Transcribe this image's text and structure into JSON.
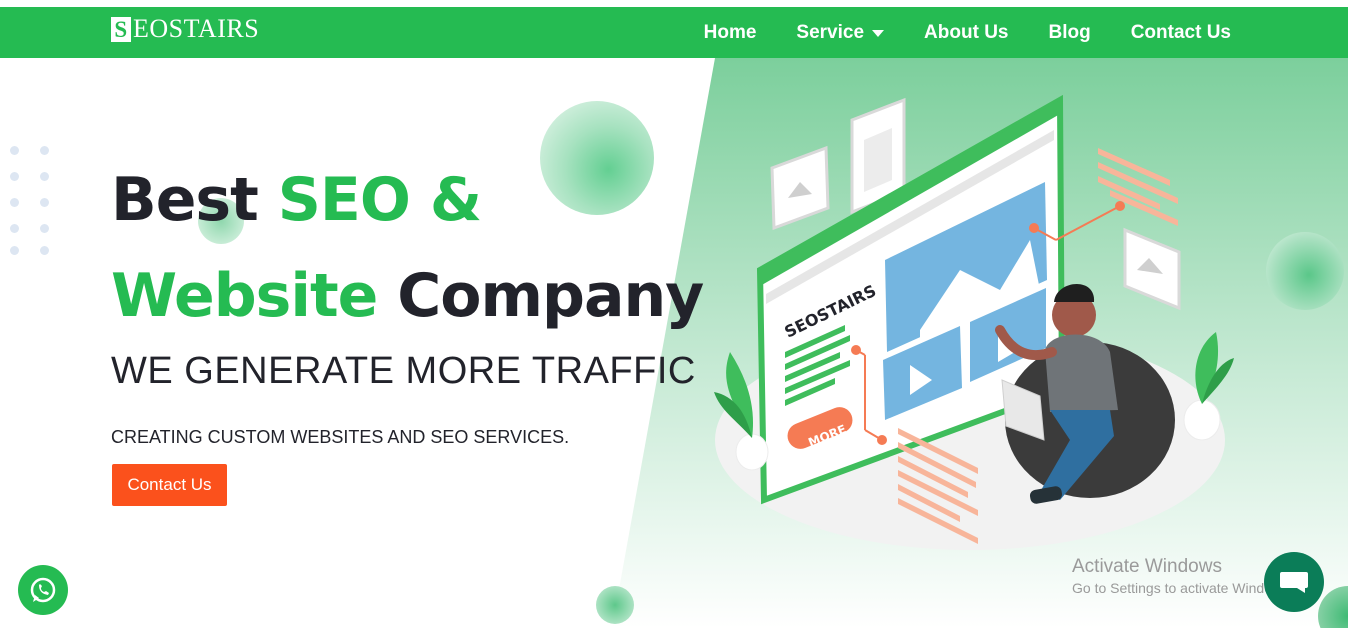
{
  "brand": {
    "logo_letter": "S",
    "logo_rest": "EOSTAIRS",
    "color": "#25bb52"
  },
  "nav": {
    "items": [
      {
        "label": "Home"
      },
      {
        "label": "Service"
      },
      {
        "label": "About Us"
      },
      {
        "label": "Blog"
      },
      {
        "label": "Contact Us"
      }
    ]
  },
  "hero": {
    "title_part1": "Best ",
    "title_part2": "SEO &",
    "title_part3": "Website",
    "title_part4": " Company",
    "tagline": "WE GENERATE MORE TRAFFIC",
    "subline": "CREATING CUSTOM WEBSITES AND SEO SERVICES.",
    "cta_label": "Contact Us",
    "cta_color": "#fb511c"
  },
  "illustration": {
    "browser_brand": "SEOSTAIRS",
    "more_label": "MORE"
  },
  "watermark": {
    "line1": "Activate Windows",
    "line2": "Go to Settings to activate Windows."
  },
  "icons": {
    "whatsapp": "whatsapp-icon",
    "chat": "chat-icon"
  }
}
